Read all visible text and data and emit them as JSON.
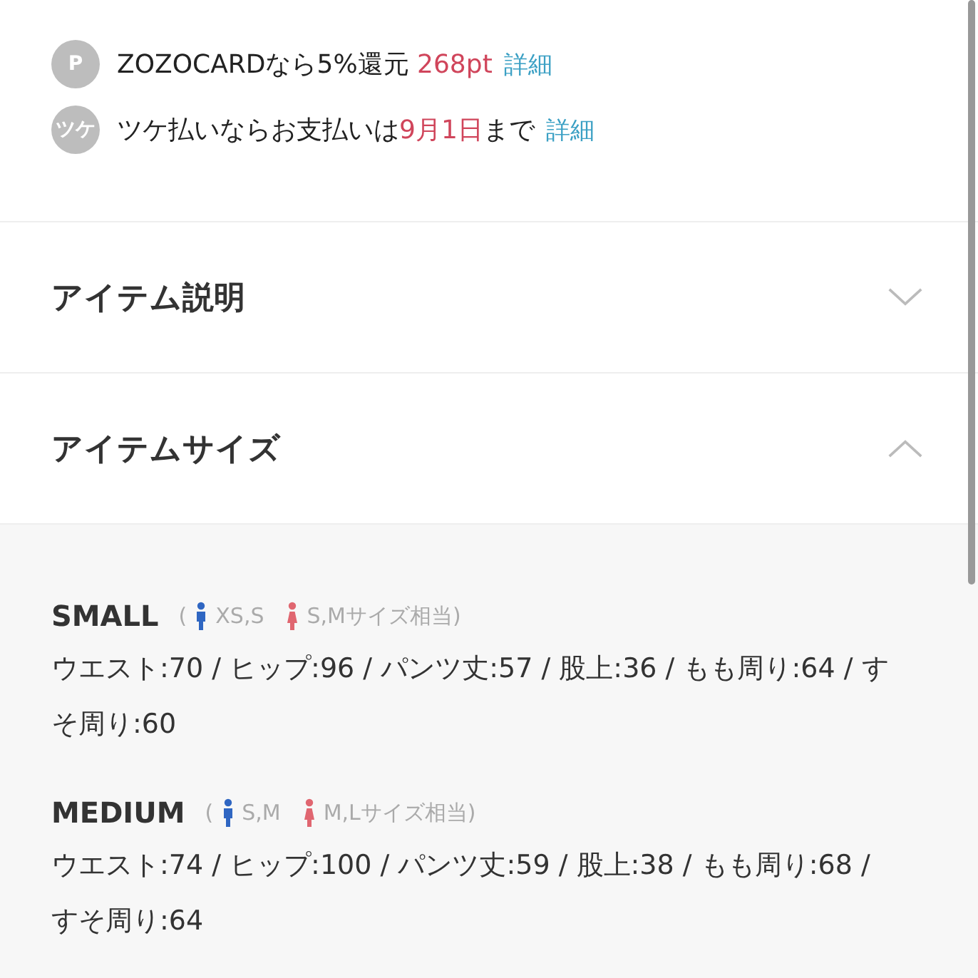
{
  "info_lines": [
    {
      "icon_label": "P",
      "parts": [
        {
          "kind": "text",
          "text": "ZOZOCARDなら5%還元 "
        },
        {
          "kind": "highlight",
          "text": "268pt"
        },
        {
          "kind": "link",
          "text": "詳細"
        }
      ]
    },
    {
      "icon_label": "ツケ",
      "parts": [
        {
          "kind": "text",
          "text": "ツケ払いならお支払いは"
        },
        {
          "kind": "highlight",
          "text": "9月1日"
        },
        {
          "kind": "text",
          "text": "まで"
        },
        {
          "kind": "link",
          "text": "詳細"
        }
      ]
    }
  ],
  "sections": [
    {
      "title": "アイテム説明",
      "expanded": false
    },
    {
      "title": "アイテムサイズ",
      "expanded": true
    }
  ],
  "sizes": [
    {
      "name": "SMALL",
      "open_paren": "(",
      "men": "XS,S",
      "women": "S,Mサイズ相当)",
      "measurements": "ウエスト:70 / ヒップ:96 / パンツ丈:57 / 股上:36 / もも周り:64 / すそ周り:60"
    },
    {
      "name": "MEDIUM",
      "open_paren": "(",
      "men": "S,M",
      "women": "M,Lサイズ相当)",
      "measurements": "ウエスト:74 / ヒップ:100 / パンツ丈:59 / 股上:38 / もも周り:68 / すそ周り:64"
    }
  ]
}
